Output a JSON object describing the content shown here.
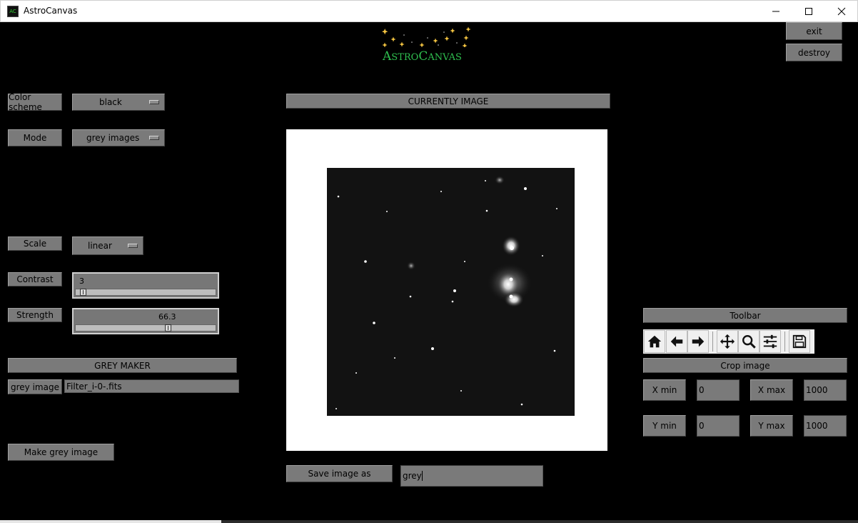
{
  "window": {
    "title": "AstroCanvas",
    "icon_text": "AC"
  },
  "logo": {
    "text_big_first": "A",
    "text_small_first": "STRO",
    "text_big_second": "C",
    "text_small_second": "ANVAS"
  },
  "top_buttons": {
    "exit": "exit",
    "destroy": "destroy"
  },
  "left_panel": {
    "color_scheme": {
      "label": "Color scheme",
      "value": "black"
    },
    "mode": {
      "label": "Mode",
      "value": "grey images"
    },
    "scale": {
      "label": "Scale",
      "value": "linear"
    },
    "contrast": {
      "label": "Contrast",
      "value": "3",
      "level": 0.03
    },
    "strength": {
      "label": "Strength",
      "value": "66.3",
      "level": 0.663
    },
    "grey_maker": {
      "header": "GREY MAKER",
      "grey_image_label": "grey image",
      "grey_image_value": "Filter_i-0-.fits",
      "make_button": "Make grey image"
    }
  },
  "center": {
    "header": "CURRENTLY IMAGE",
    "save_button": "Save image as",
    "save_value": "grey"
  },
  "right_panel": {
    "toolbar_header": "Toolbar",
    "toolbar_icons": [
      "home-icon",
      "back-arrow-icon",
      "forward-arrow-icon",
      "pan-icon",
      "zoom-icon",
      "configure-subplots-icon",
      "save-icon"
    ],
    "crop_header": "Crop image",
    "x_min_label": "X min",
    "x_min_value": "0",
    "x_max_label": "X max",
    "x_max_value": "1000",
    "y_min_label": "Y min",
    "y_min_value": "0",
    "y_max_label": "Y max",
    "y_max_value": "1000"
  },
  "colors": {
    "background": "#000000",
    "widget_grey": "#7a7a7a",
    "logo_green": "#2fbf4f",
    "logo_star": "#f5c542"
  }
}
